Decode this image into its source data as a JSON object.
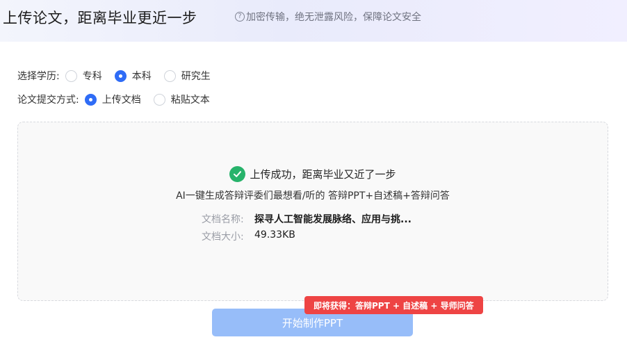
{
  "header": {
    "title": "上传论文，距离毕业更近一步",
    "hint_icon": "question-circle-icon",
    "hint": "加密传输，绝无泄露风险，保障论文安全"
  },
  "form": {
    "education": {
      "label": "选择学历:",
      "options": [
        {
          "label": "专科",
          "checked": false
        },
        {
          "label": "本科",
          "checked": true
        },
        {
          "label": "研究生",
          "checked": false
        }
      ]
    },
    "submit_method": {
      "label": "论文提交方式:",
      "options": [
        {
          "label": "上传文档",
          "checked": true
        },
        {
          "label": "粘贴文本",
          "checked": false
        }
      ]
    }
  },
  "upload": {
    "success_icon": "check-circle-icon",
    "success_text": "上传成功，距离毕业又近了一步",
    "subtitle": "AI一键生成答辩评委们最想看/听的 答辩PPT+自述稿+答辩问答",
    "file_name_label": "文档名称:",
    "file_name": "探寻人工智能发展脉络、应用与挑...",
    "file_size_label": "文档大小:",
    "file_size": "49.33KB"
  },
  "action": {
    "start_label": "开始制作PPT",
    "promo": "即将获得：答辩PPT + 自述稿 + 导师问答"
  },
  "colors": {
    "accent": "#2f6cf6",
    "button_disabled": "#97bdf9",
    "success": "#27b36b",
    "promo": "#ee4444"
  }
}
